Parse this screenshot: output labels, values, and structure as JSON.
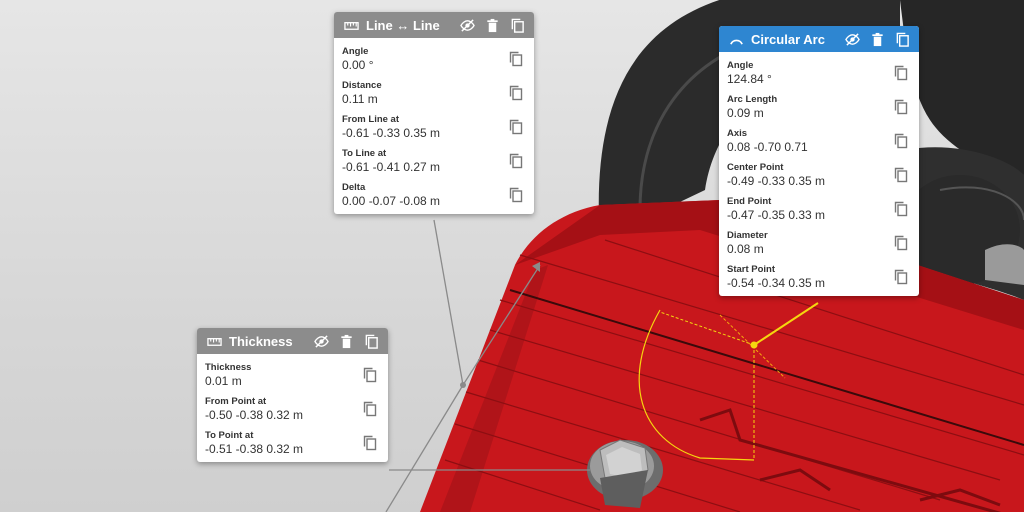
{
  "panels": {
    "line": {
      "title": "Line ↔ Line",
      "header_color": "#8c8c8c",
      "icon": "ruler-icon",
      "rows": [
        {
          "label": "Angle",
          "value": "0.00 °"
        },
        {
          "label": "Distance",
          "value": "0.11 m"
        },
        {
          "label": "From Line at",
          "value": "-0.61 -0.33 0.35 m"
        },
        {
          "label": "To Line at",
          "value": "-0.61 -0.41 0.27 m"
        },
        {
          "label": "Delta",
          "value": "0.00 -0.07 -0.08 m"
        }
      ]
    },
    "arc": {
      "title": "Circular Arc",
      "header_color": "#2e86d1",
      "icon": "arc-icon",
      "rows": [
        {
          "label": "Angle",
          "value": "124.84 °"
        },
        {
          "label": "Arc Length",
          "value": "0.09 m"
        },
        {
          "label": "Axis",
          "value": "0.08 -0.70 0.71"
        },
        {
          "label": "Center Point",
          "value": "-0.49 -0.33 0.35 m"
        },
        {
          "label": "End Point",
          "value": "-0.47 -0.35 0.33 m"
        },
        {
          "label": "Diameter",
          "value": "0.08 m"
        },
        {
          "label": "Start Point",
          "value": "-0.54 -0.34 0.35 m"
        }
      ]
    },
    "thickness": {
      "title": "Thickness",
      "header_color": "#8c8c8c",
      "icon": "ruler-icon",
      "rows": [
        {
          "label": "Thickness",
          "value": "0.01 m"
        },
        {
          "label": "From Point at",
          "value": "-0.50 -0.38 0.32 m"
        },
        {
          "label": "To Point at",
          "value": "-0.51 -0.38 0.32 m"
        }
      ]
    }
  },
  "header_icons": [
    "visibility-off-icon",
    "trash-icon",
    "copy-icon"
  ],
  "colors": {
    "model_red": "#c8171c",
    "highlight_yellow": "#f5d60f",
    "background": "#dcdcdc"
  }
}
